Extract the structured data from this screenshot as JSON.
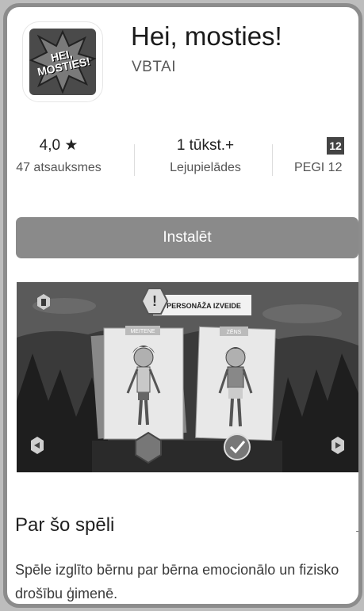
{
  "app": {
    "title": "Hei, mosties!",
    "developer": "VBTAI",
    "icon_text": "HEI, MOSTIES!"
  },
  "stats": [
    {
      "value": "4,0",
      "label": "47 atsauksmes",
      "icon": "star-icon"
    },
    {
      "value": "1 tūkst.+",
      "label": "Lejupielādes"
    },
    {
      "value": "12",
      "label": "PEGI 12",
      "icon": "pegi-badge-icon"
    }
  ],
  "install_label": "Instalēt",
  "screenshot": {
    "banner": "PERSONĀŽA IZVEIDE",
    "tag_left": "MEITENE",
    "tag_right": "ZĒNS"
  },
  "about": {
    "title": "Par šo spēli",
    "description": "Spēle izglīto bērnu par bērna emocionālo un fizisko drošību ģimenē."
  },
  "colors": {
    "install": "#8a8a8a",
    "text": "#1a1a1a"
  }
}
